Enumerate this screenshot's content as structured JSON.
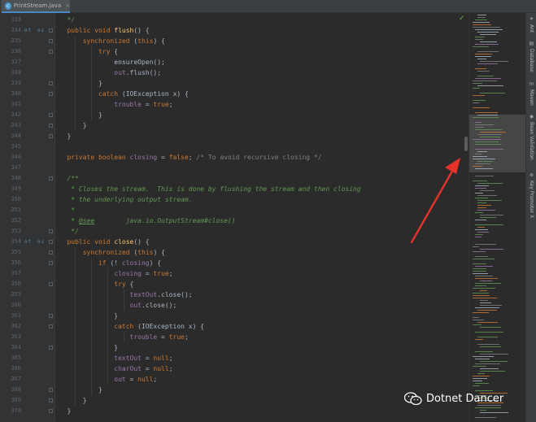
{
  "tab": {
    "filename": "PrintStream.java",
    "icon": "java-class-icon",
    "close": "×"
  },
  "gutter_markers": [
    "o↑",
    "o↓"
  ],
  "status_icon": "✓",
  "code_lines": [
    {
      "n": "333",
      "html": "   <span class=\"doc\">*/</span>"
    },
    {
      "n": "334",
      "html": "   <span class=\"kw\">public void </span><span class=\"fn\">flush</span>() {"
    },
    {
      "n": "335",
      "html": "       <span class=\"kw\">synchronized </span>(<span class=\"kw\">this</span>) {"
    },
    {
      "n": "336",
      "html": "           <span class=\"kw\">try </span>{"
    },
    {
      "n": "337",
      "html": "               ensureOpen();"
    },
    {
      "n": "338",
      "html": "               <span class=\"fld\">out</span>.flush();"
    },
    {
      "n": "339",
      "html": "           }"
    },
    {
      "n": "340",
      "html": "           <span class=\"kw\">catch </span>(IOException x) {"
    },
    {
      "n": "341",
      "html": "               <span class=\"fld\">trouble </span>= <span class=\"kw\">true</span>;"
    },
    {
      "n": "342",
      "html": "           }"
    },
    {
      "n": "343",
      "html": "       }"
    },
    {
      "n": "344",
      "html": "   }"
    },
    {
      "n": "345",
      "html": ""
    },
    {
      "n": "346",
      "html": "   <span class=\"kw\">private boolean </span><span class=\"fld\">closing </span>= <span class=\"kw\">false</span>; <span class=\"cmt\">/* To avoid recursive closing */</span>"
    },
    {
      "n": "347",
      "html": ""
    },
    {
      "n": "348",
      "html": "   <span class=\"doc\">/**</span>"
    },
    {
      "n": "349",
      "html": "   <span class=\"doc\"> * Closes the stream.  This is done by flushing the stream and then closing</span>"
    },
    {
      "n": "350",
      "html": "   <span class=\"doc\"> * the underlying output stream.</span>"
    },
    {
      "n": "351",
      "html": "   <span class=\"doc\"> *</span>"
    },
    {
      "n": "352",
      "html": "   <span class=\"doc\"> * </span><span class=\"tag\">@see</span><span class=\"doc\">        java.io.OutputStream#close()</span>"
    },
    {
      "n": "353",
      "html": "   <span class=\"doc\"> */</span>"
    },
    {
      "n": "354",
      "html": "   <span class=\"kw\">public void </span><span class=\"fn\">close</span>() {"
    },
    {
      "n": "355",
      "html": "       <span class=\"kw\">synchronized </span>(<span class=\"kw\">this</span>) {"
    },
    {
      "n": "356",
      "html": "           <span class=\"kw\">if </span>(! <span class=\"fld\">closing</span>) {"
    },
    {
      "n": "357",
      "html": "               <span class=\"fld\">closing </span>= <span class=\"kw\">true</span>;"
    },
    {
      "n": "358",
      "html": "               <span class=\"kw\">try </span>{"
    },
    {
      "n": "359",
      "html": "                   <span class=\"fld\">textOut</span>.close();"
    },
    {
      "n": "360",
      "html": "                   <span class=\"fld\">out</span>.close();"
    },
    {
      "n": "361",
      "html": "               }"
    },
    {
      "n": "362",
      "html": "               <span class=\"kw\">catch </span>(IOException x) {"
    },
    {
      "n": "363",
      "html": "                   <span class=\"fld\">trouble </span>= <span class=\"kw\">true</span>;"
    },
    {
      "n": "364",
      "html": "               }"
    },
    {
      "n": "365",
      "html": "               <span class=\"fld\">textOut </span>= <span class=\"kw\">null</span>;"
    },
    {
      "n": "366",
      "html": "               <span class=\"fld\">charOut </span>= <span class=\"kw\">null</span>;"
    },
    {
      "n": "367",
      "html": "               <span class=\"fld\">out </span>= <span class=\"kw\">null</span>;"
    },
    {
      "n": "368",
      "html": "           }"
    },
    {
      "n": "369",
      "html": "       }"
    },
    {
      "n": "370",
      "html": "   }"
    }
  ],
  "tool_windows": [
    {
      "label": "Ant",
      "icon": "ant-icon",
      "glyph": "✦"
    },
    {
      "label": "Database",
      "icon": "database-icon",
      "glyph": "▤"
    },
    {
      "label": "Maven",
      "icon": "maven-icon",
      "glyph": "m"
    },
    {
      "label": "Bean Validation",
      "icon": "bean-validation-icon",
      "glyph": "◉"
    },
    {
      "label": "Key Promoter X",
      "icon": "key-promoter-icon",
      "glyph": "⊗"
    }
  ],
  "watermark": {
    "text": "Dotnet Dancer",
    "icon": "wechat-icon"
  },
  "colors": {
    "editor_bg": "#2b2b2b",
    "keyword": "#cc7832",
    "method": "#ffc66d",
    "field": "#9876aa",
    "doc_comment": "#629755",
    "comment": "#808080",
    "arrow": "#e5332a"
  }
}
